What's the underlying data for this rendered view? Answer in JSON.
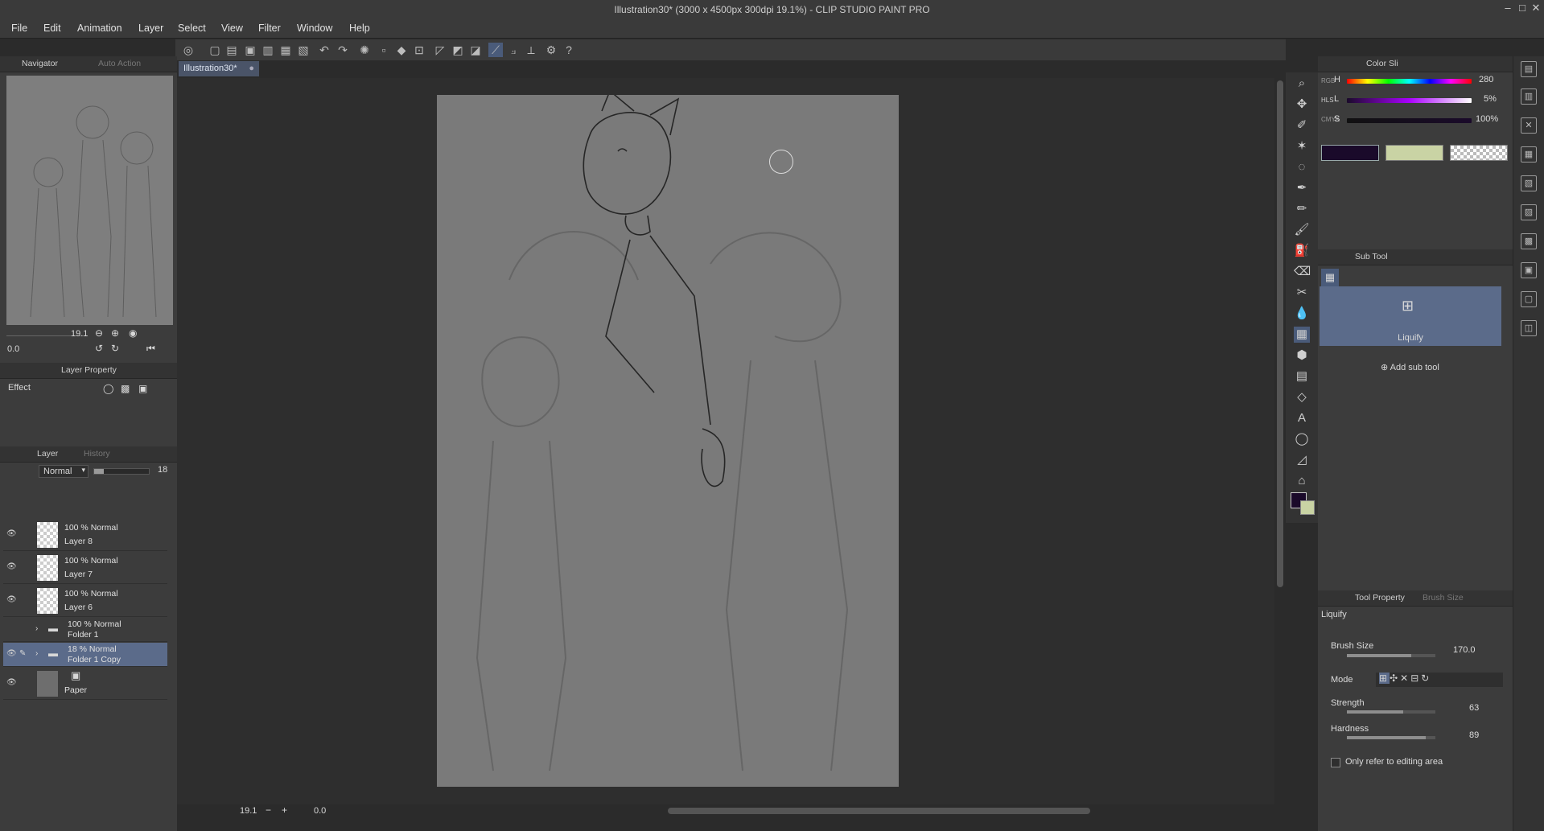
{
  "window": {
    "title": "Illustration30* (3000 x 4500px 300dpi 19.1%)  - CLIP STUDIO PAINT PRO"
  },
  "menu": [
    "File",
    "Edit",
    "Animation",
    "Layer",
    "Select",
    "View",
    "Filter",
    "Window",
    "Help"
  ],
  "document_tab": {
    "label": "Illustration30*"
  },
  "navigator": {
    "tabs": [
      "Navigator",
      "Auto Action"
    ],
    "zoom": "19.1",
    "rotation": "0.0"
  },
  "layer_property": {
    "tab": "Layer Property",
    "effect_label": "Effect"
  },
  "layer_panel": {
    "tabs": [
      "Layer",
      "History"
    ],
    "blend_mode": "Normal",
    "opacity": "18",
    "layers": [
      {
        "line1": "100 % Normal",
        "line2": "Layer 8",
        "visible": true
      },
      {
        "line1": "100 % Normal",
        "line2": "Layer 7",
        "visible": true
      },
      {
        "line1": "100 % Normal",
        "line2": "Layer 6",
        "visible": true
      },
      {
        "line1": "100 % Normal",
        "line2": "Folder 1",
        "visible": false,
        "folder": true
      },
      {
        "line1": "18 % Normal",
        "line2": "Folder 1 Copy",
        "visible": true,
        "folder": true,
        "selected": true
      },
      {
        "line1": "",
        "line2": "Paper",
        "visible": true
      }
    ]
  },
  "color_panel": {
    "tab": "Color Sli",
    "side_labels": [
      "RGB",
      "HLS",
      "CMYK"
    ],
    "rows": [
      {
        "label": "H",
        "value": "280"
      },
      {
        "label": "L",
        "value": "5%"
      },
      {
        "label": "S",
        "value": "100%"
      }
    ],
    "main_color": "#1a0a2a",
    "sub_color": "#c9d3a4"
  },
  "sub_tool": {
    "tab": "Sub Tool",
    "item": "Liquify",
    "add_label": "Add sub tool"
  },
  "tool_property": {
    "tabs": [
      "Tool Property",
      "Brush Size"
    ],
    "tool_name": "Liquify",
    "brush_size_label": "Brush Size",
    "brush_size": "170.0",
    "mode_label": "Mode",
    "strength_label": "Strength",
    "strength": "63",
    "hardness_label": "Hardness",
    "hardness": "89",
    "only_refer_label": "Only refer to editing area"
  },
  "canvas_footer": {
    "zoom": "19.1",
    "angle": "0.0"
  },
  "colors": {
    "accent": "#5b6b8a"
  }
}
